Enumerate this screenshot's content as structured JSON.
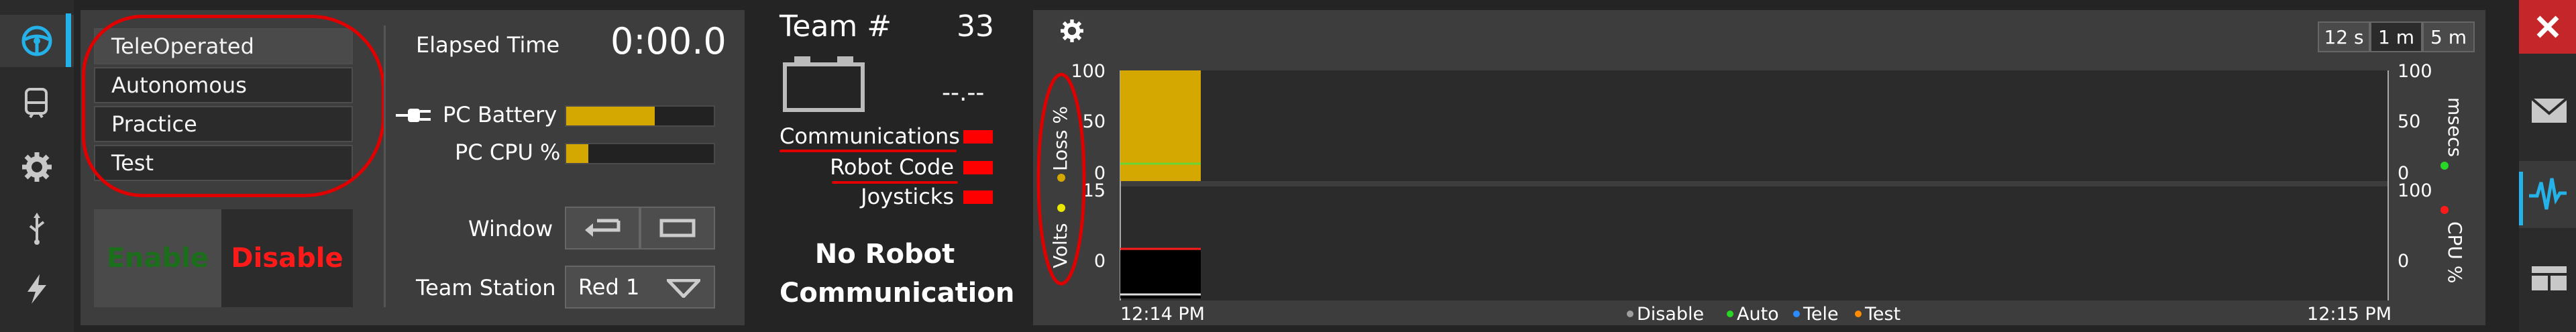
{
  "modes": [
    "TeleOperated",
    "Autonomous",
    "Practice",
    "Test"
  ],
  "selected_mode": "TeleOperated",
  "enable_label": "Enable",
  "disable_label": "Disable",
  "elapsed_label": "Elapsed Time",
  "elapsed_value": "0:00.0",
  "pc_battery_label": "PC Battery",
  "pc_battery_level": 0.6,
  "pc_cpu_label": "PC CPU %",
  "pc_cpu_level": 0.15,
  "window_label": "Window",
  "team_station_label": "Team Station",
  "team_station_value": "Red 1",
  "team_label": "Team #",
  "team_number": "33",
  "battery_voltage": "--.--",
  "status_items": [
    {
      "label": "Communications",
      "color": "#ff0000"
    },
    {
      "label": "Robot Code",
      "color": "#ff0000"
    },
    {
      "label": "Joysticks",
      "color": "#ff0000"
    }
  ],
  "no_robot_line1": "No Robot",
  "no_robot_line2": "Communication",
  "chart_data": [
    {
      "type": "area",
      "ylabel": "Loss %",
      "ylabel_right": "msecs",
      "yticks": [
        "100",
        "50",
        "0"
      ],
      "yticks_right": [
        "100",
        "50",
        "0"
      ],
      "ylim": [
        0,
        100
      ],
      "series": [
        {
          "name": "Loss %",
          "color": "#d4a800",
          "x_range": [
            "12:14 PM",
            "12:14 PM"
          ],
          "values": [
            100
          ]
        }
      ]
    },
    {
      "type": "line",
      "ylabel": "Volts",
      "ylabel_right": "CPU %",
      "yticks": [
        "15",
        "0"
      ],
      "yticks_right": [
        "100",
        "0"
      ],
      "ylim": [
        0,
        15
      ]
    }
  ],
  "chart_xlabels": [
    "12:14 PM",
    "12:15 PM"
  ],
  "chart_legend": [
    {
      "label": "Disable",
      "color": "#9e9e9e"
    },
    {
      "label": "Auto",
      "color": "#27d627"
    },
    {
      "label": "Tele",
      "color": "#2b8cff"
    },
    {
      "label": "Test",
      "color": "#ff8c00"
    }
  ],
  "time_buttons": [
    "12 s",
    "1 m",
    "5 m"
  ],
  "time_selected": "1 m",
  "colors": {
    "accent": "#25b2e8",
    "disable": "#ff1a1a",
    "enable": "#1b6f1b",
    "bar": "#d4a800",
    "annotation": "#e00000"
  }
}
